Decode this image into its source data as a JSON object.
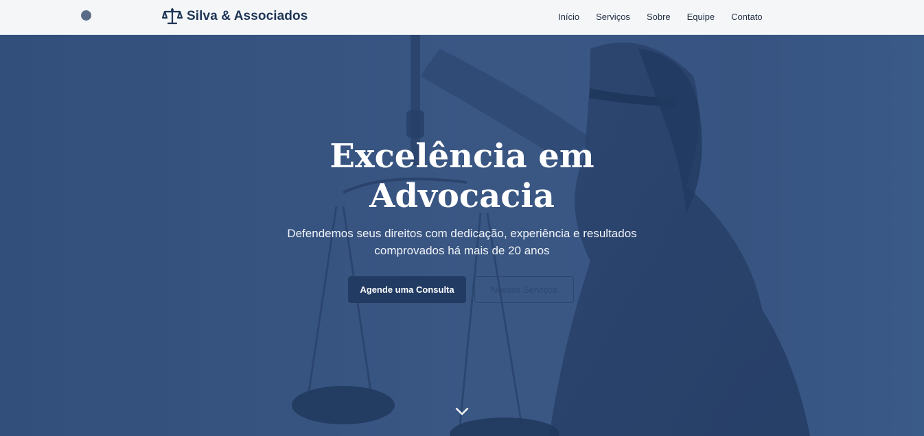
{
  "brand": {
    "name": "Silva & Associados",
    "logo_icon": "scales-icon"
  },
  "nav": {
    "items": [
      "Início",
      "Serviços",
      "Sobre",
      "Equipe",
      "Contato"
    ]
  },
  "hero": {
    "title_line1": "Excelência em",
    "title_line2": "Advocacia",
    "subtitle_line1": "Defendemos seus direitos com dedicação, experiência e resultados",
    "subtitle_line2": "comprovados há mais de 20 anos",
    "primary_button": "Agende uma Consulta",
    "secondary_button": "Nossos Serviços",
    "scroll_icon": "chevron-down-icon"
  },
  "colors": {
    "brand": "#1e3556",
    "hero_overlay": "#3f5a85",
    "primary_button": "#213b63"
  }
}
